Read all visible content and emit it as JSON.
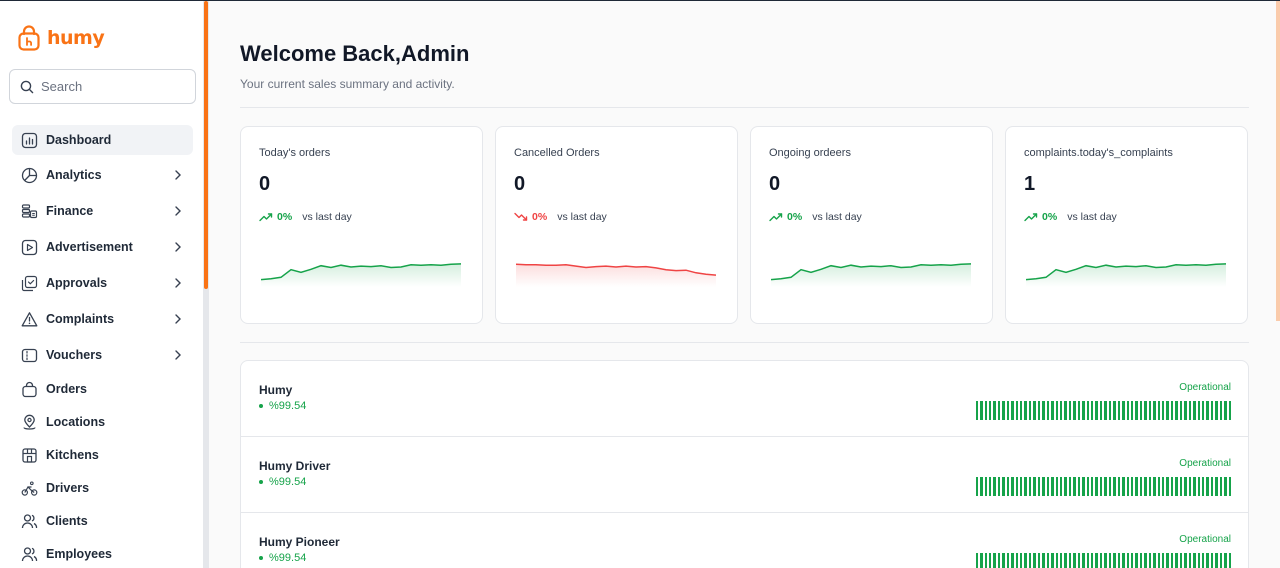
{
  "brand": {
    "name": "humy",
    "color": "#f97316"
  },
  "search": {
    "placeholder": "Search"
  },
  "nav": [
    {
      "label": "Dashboard",
      "icon": "chart-bar-icon",
      "active": true,
      "has_submenu": false
    },
    {
      "label": "Analytics",
      "icon": "pie-chart-icon",
      "has_submenu": true
    },
    {
      "label": "Finance",
      "icon": "coins-icon",
      "has_submenu": true
    },
    {
      "label": "Advertisement",
      "icon": "play-box-icon",
      "has_submenu": true
    },
    {
      "label": "Approvals",
      "icon": "check-document-icon",
      "has_submenu": true
    },
    {
      "label": "Complaints",
      "icon": "warning-triangle-icon",
      "has_submenu": true
    },
    {
      "label": "Vouchers",
      "icon": "voucher-icon",
      "has_submenu": true
    },
    {
      "label": "Orders",
      "icon": "shopping-bag-icon",
      "has_submenu": false
    },
    {
      "label": "Locations",
      "icon": "location-pin-icon",
      "has_submenu": false
    },
    {
      "label": "Kitchens",
      "icon": "store-icon",
      "has_submenu": false
    },
    {
      "label": "Drivers",
      "icon": "bicycle-icon",
      "has_submenu": false
    },
    {
      "label": "Clients",
      "icon": "users-icon",
      "has_submenu": false
    },
    {
      "label": "Employees",
      "icon": "users-icon",
      "has_submenu": false
    }
  ],
  "header": {
    "title": "Welcome Back,Admin",
    "subtitle": "Your current sales summary and activity."
  },
  "stats": [
    {
      "title": "Today's orders",
      "value": "0",
      "change": "0%",
      "direction": "up",
      "compare": "vs last day",
      "color": "#16a34a",
      "chart_data": {
        "type": "line",
        "values": [
          3.0,
          3.2,
          3.5,
          5.2,
          4.6,
          5.3,
          6.1,
          5.7,
          6.2,
          5.8,
          6.0,
          5.9,
          6.1,
          5.7,
          5.8,
          6.3,
          6.2,
          6.3,
          6.2,
          6.4,
          6.5
        ]
      }
    },
    {
      "title": "Cancelled Orders",
      "value": "0",
      "change": "0%",
      "direction": "down",
      "compare": "vs last day",
      "color": "#ef4444",
      "chart_data": {
        "type": "line",
        "values": [
          6.4,
          6.3,
          6.3,
          6.2,
          6.2,
          6.3,
          6.0,
          5.7,
          5.9,
          6.0,
          5.8,
          6.0,
          5.8,
          5.9,
          5.6,
          5.2,
          5.0,
          5.1,
          4.5,
          4.2,
          4.0
        ]
      }
    },
    {
      "title": "Ongoing ordeers",
      "value": "0",
      "change": "0%",
      "direction": "up",
      "compare": "vs last day",
      "color": "#16a34a",
      "chart_data": {
        "type": "line",
        "values": [
          3.0,
          3.2,
          3.5,
          5.2,
          4.6,
          5.3,
          6.1,
          5.7,
          6.2,
          5.8,
          6.0,
          5.9,
          6.1,
          5.7,
          5.8,
          6.3,
          6.2,
          6.3,
          6.2,
          6.4,
          6.5
        ]
      }
    },
    {
      "title": "complaints.today's_complaints",
      "value": "1",
      "change": "0%",
      "direction": "up",
      "compare": "vs last day",
      "color": "#16a34a",
      "chart_data": {
        "type": "line",
        "values": [
          3.0,
          3.2,
          3.5,
          5.2,
          4.6,
          5.3,
          6.1,
          5.7,
          6.2,
          5.8,
          6.0,
          5.9,
          6.1,
          5.7,
          5.8,
          6.3,
          6.2,
          6.3,
          6.2,
          6.4,
          6.5
        ]
      }
    }
  ],
  "services": [
    {
      "name": "Humy",
      "uptime": "%99.54",
      "status": "Operational"
    },
    {
      "name": "Humy Driver",
      "uptime": "%99.54",
      "status": "Operational"
    },
    {
      "name": "Humy Pioneer",
      "uptime": "%99.54",
      "status": "Operational"
    }
  ],
  "status_color": "#16a34a"
}
